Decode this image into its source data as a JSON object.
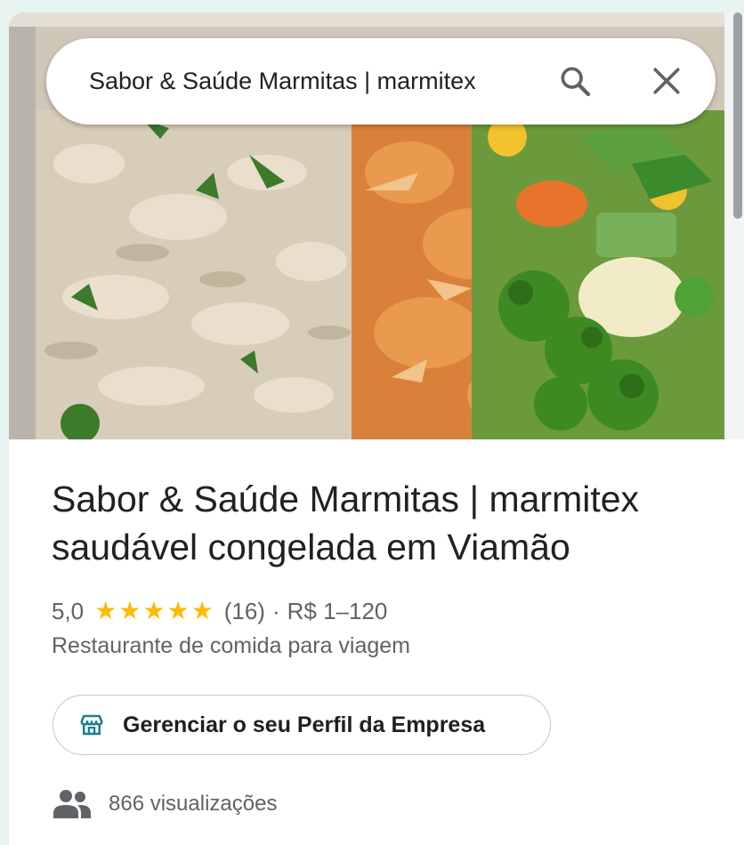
{
  "search": {
    "value": "Sabor & Saúde Marmitas | marmitex",
    "search_icon": "search-icon",
    "close_icon": "close-icon"
  },
  "photo": {
    "subject": "food-photo"
  },
  "place": {
    "title": "Sabor & Saúde Marmitas | marmitex saudável congelada em Viamão",
    "rating": "5,0",
    "stars": 5,
    "reviews": "(16)",
    "separator": "·",
    "price": "R$ 1–120",
    "category": "Restaurante de comida para viagem"
  },
  "manage_profile": {
    "label": "Gerenciar o seu Perfil da Empresa",
    "icon": "storefront-icon"
  },
  "views": {
    "text": "866 visualizações",
    "icon": "people-icon"
  },
  "colors": {
    "star": "#fbbc04",
    "storefront": "#1a7f8e",
    "background": "#e7f3f0"
  }
}
